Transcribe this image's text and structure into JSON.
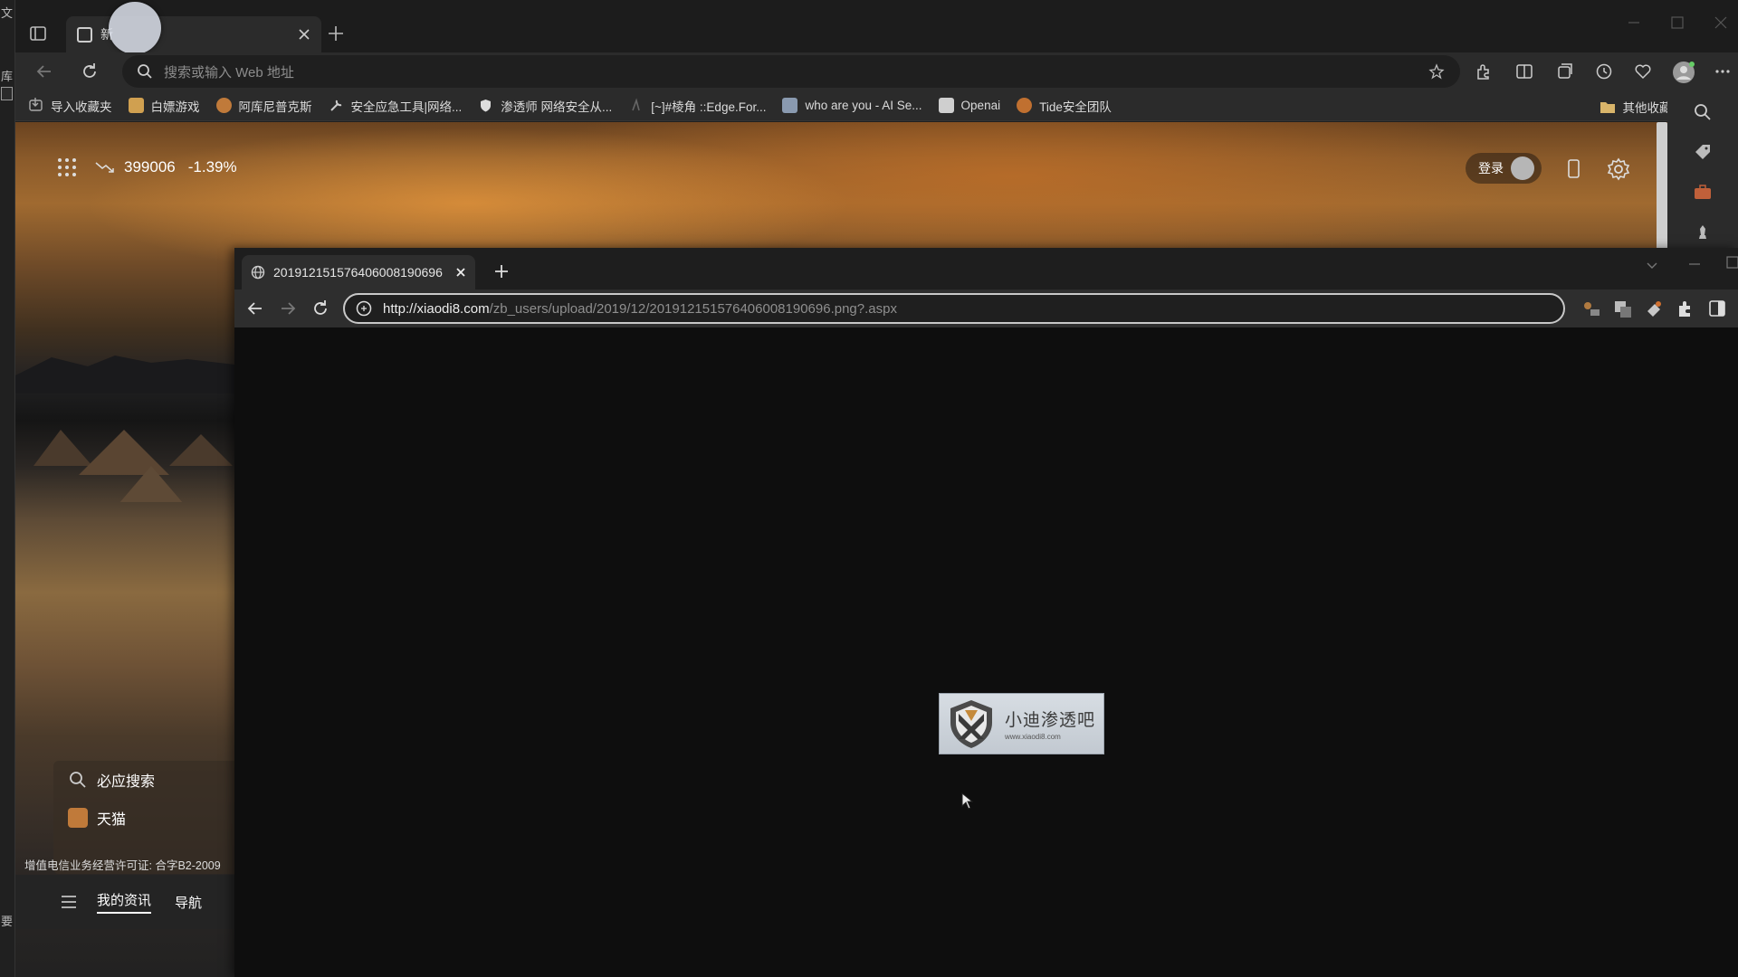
{
  "desktop": {
    "strip_chars": [
      "文",
      "库",
      "要"
    ]
  },
  "edge": {
    "tab_title": "新",
    "address_placeholder": "搜索或输入 Web 地址",
    "bookmarks": [
      {
        "label": "导入收藏夹",
        "icon": "import-icon",
        "color": "#9a9a9a"
      },
      {
        "label": "白嫖游戏",
        "icon": "game-icon",
        "color": "#d0a050"
      },
      {
        "label": "阿库尼普克斯",
        "icon": "site-icon",
        "color": "#c07a3a"
      },
      {
        "label": "安全应急工具|网络...",
        "icon": "tool-icon",
        "color": "#cccccc"
      },
      {
        "label": "渗透师 网络安全从...",
        "icon": "shield-icon",
        "color": "#dddddd"
      },
      {
        "label": "[~]#棱角 ::Edge.For...",
        "icon": "edge-icon",
        "color": "#555555"
      },
      {
        "label": "who are you - AI Se...",
        "icon": "ai-icon",
        "color": "#8a9ab0"
      },
      {
        "label": "Openai",
        "icon": "openai-icon",
        "color": "#cccccc"
      },
      {
        "label": "Tide安全团队",
        "icon": "tide-icon",
        "color": "#c07030"
      }
    ],
    "other_bookmarks": "其他收藏夹",
    "newtab": {
      "stock_value": "399006",
      "stock_change": "-1.39%",
      "login_label": "登录",
      "quicklinks": [
        {
          "label": "必应搜索",
          "icon": "search-icon"
        },
        {
          "label": "天猫",
          "icon": "tmall-icon"
        }
      ],
      "license_text": "增值电信业务经营许可证: 合字B2-2009",
      "bottom_nav": [
        {
          "label": "我的资讯"
        },
        {
          "label": "导航"
        }
      ]
    }
  },
  "chrome": {
    "tab_title": "20191215157640600819069​6",
    "url_host": "http://xiaodi8.com",
    "url_path": "/zb_users/upload/2019/12/201912151576406008190696.png?.aspx",
    "image": {
      "main_text": "小迪渗透吧",
      "sub_text": "www.xiaodi8.com"
    }
  },
  "colors": {
    "accent_orange": "#a06a30",
    "chrome_bg": "#0e0e0e",
    "edge_bg": "#2b2b2b"
  }
}
